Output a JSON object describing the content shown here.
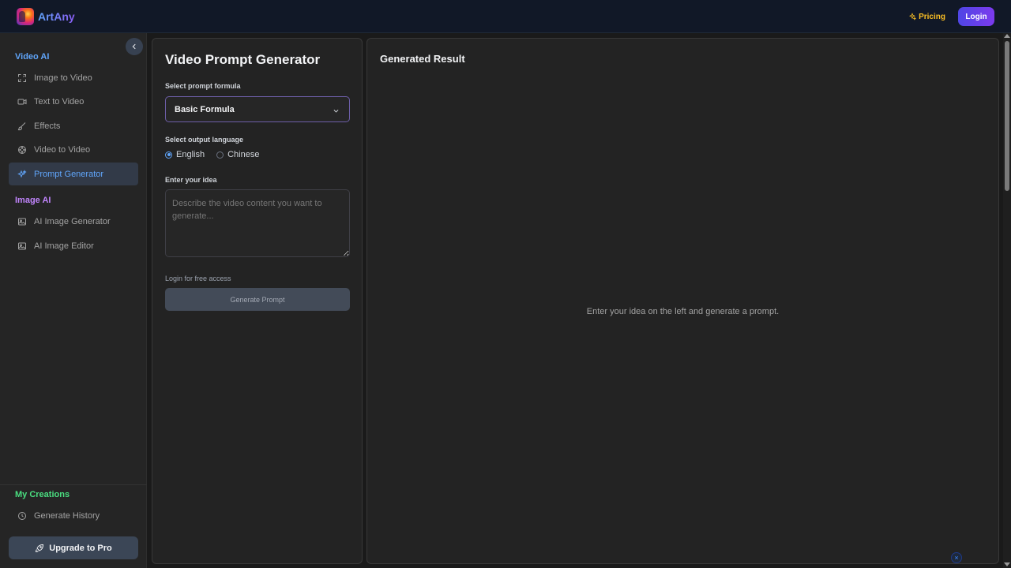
{
  "header": {
    "app_name": "ArtAny",
    "pricing_label": "Pricing",
    "login_label": "Login"
  },
  "sidebar": {
    "video_section_title": "Video AI",
    "video_items": [
      {
        "label": "Image to Video",
        "icon": "expand-icon"
      },
      {
        "label": "Text to Video",
        "icon": "video-camera-icon"
      },
      {
        "label": "Effects",
        "icon": "brush-icon"
      },
      {
        "label": "Video to Video",
        "icon": "film-reel-icon"
      },
      {
        "label": "Prompt Generator",
        "icon": "sparkles-icon",
        "active": true
      }
    ],
    "image_section_title": "Image AI",
    "image_items": [
      {
        "label": "AI Image Generator",
        "icon": "image-icon"
      },
      {
        "label": "AI Image Editor",
        "icon": "image-icon"
      }
    ],
    "creations_section_title": "My Creations",
    "creations_items": [
      {
        "label": "Generate History",
        "icon": "clock-icon"
      }
    ],
    "upgrade_label": "Upgrade to Pro"
  },
  "form": {
    "title": "Video Prompt Generator",
    "formula_label": "Select prompt formula",
    "formula_selected": "Basic Formula",
    "language_label": "Select output language",
    "language_options": [
      "English",
      "Chinese"
    ],
    "language_selected": "English",
    "idea_label": "Enter your idea",
    "idea_placeholder": "Describe the video content you want to generate...",
    "idea_value": "",
    "login_note": "Login for free access",
    "generate_label": "Generate Prompt"
  },
  "result": {
    "title": "Generated Result",
    "empty_message": "Enter your idea on the left and generate a prompt."
  },
  "colors": {
    "video_section": "#60a5fa",
    "image_section": "#c084fc",
    "creations_section": "#4ade80",
    "accent": "#7c3aed"
  }
}
